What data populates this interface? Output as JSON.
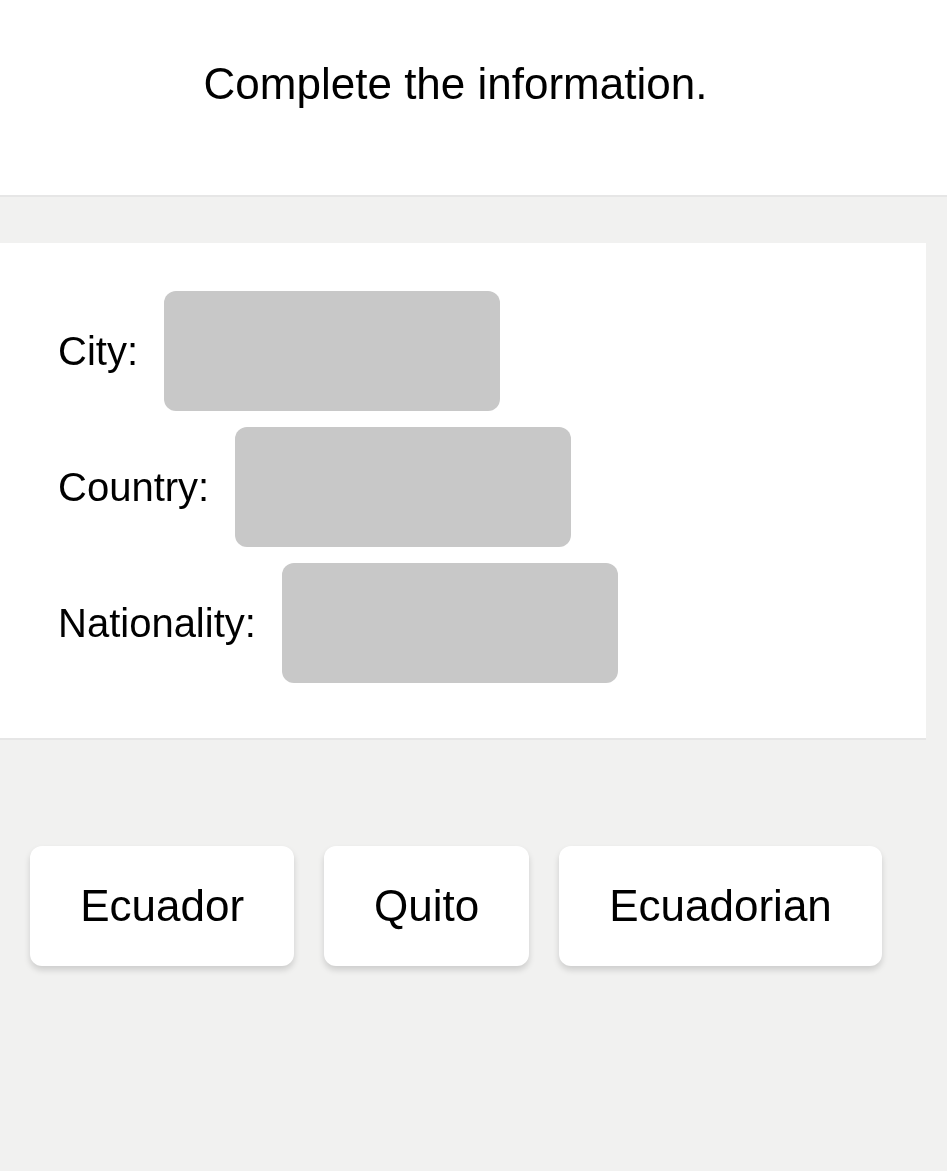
{
  "instruction": "Complete the information.",
  "blanks": [
    {
      "label": "City:"
    },
    {
      "label": "Country:"
    },
    {
      "label": "Nationality:"
    }
  ],
  "word_bank": [
    "Ecuador",
    "Quito",
    "Ecuadorian"
  ]
}
